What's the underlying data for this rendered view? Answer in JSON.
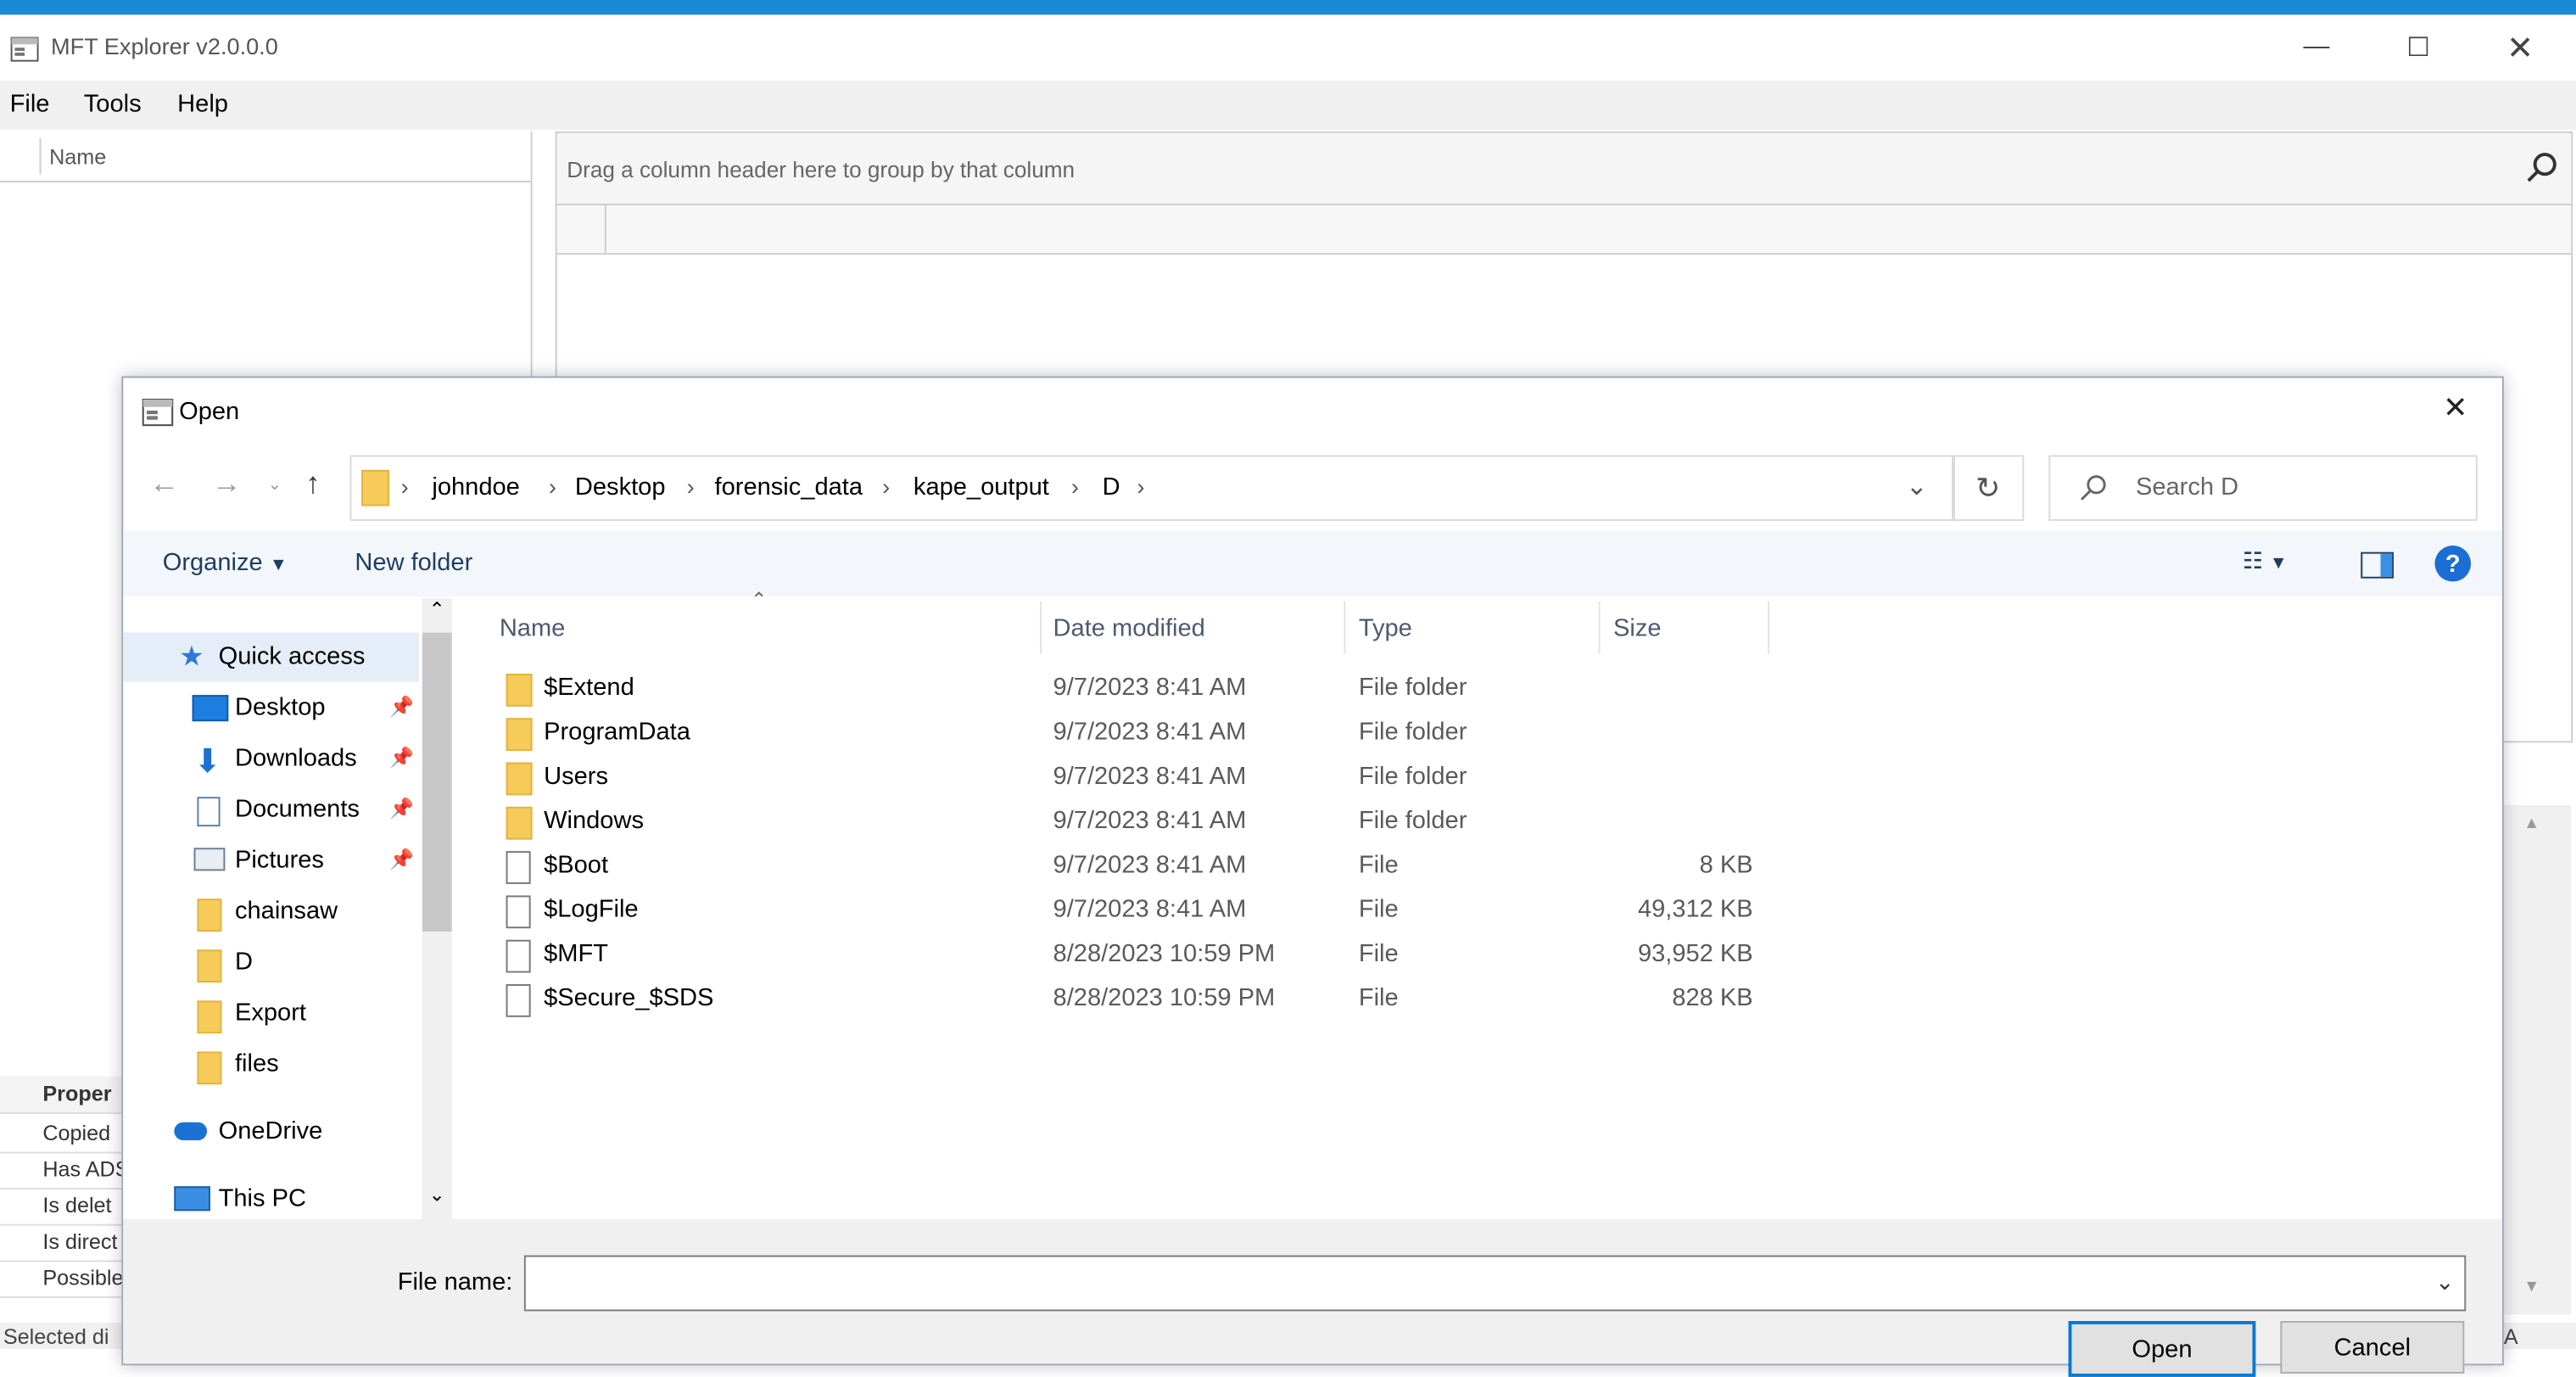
{
  "app": {
    "title": "MFT Explorer v2.0.0.0",
    "menu": [
      "File",
      "Tools",
      "Help"
    ],
    "left_header": "Name",
    "group_hint": "Drag a column header here to group by that column",
    "properties_header": "Proper",
    "properties": [
      "Copied",
      "Has ADS",
      "Is delet",
      "Is direct",
      "Possible"
    ],
    "status": "Selected di",
    "status_right": "A"
  },
  "dialog": {
    "title": "Open",
    "breadcrumb": [
      "johndoe",
      "Desktop",
      "forensic_data",
      "kape_output",
      "D"
    ],
    "search_placeholder": "Search D",
    "organize_label": "Organize",
    "new_folder_label": "New folder",
    "help_label": "?",
    "nav_items": [
      {
        "label": "Quick access",
        "icon": "star-icon",
        "selected": true
      },
      {
        "label": "Desktop",
        "icon": "desktop-icon",
        "pinned": true
      },
      {
        "label": "Downloads",
        "icon": "download-icon",
        "pinned": true
      },
      {
        "label": "Documents",
        "icon": "document-icon",
        "pinned": true
      },
      {
        "label": "Pictures",
        "icon": "picture-icon",
        "pinned": true
      },
      {
        "label": "chainsaw",
        "icon": "folder-icon"
      },
      {
        "label": "D",
        "icon": "folder-icon"
      },
      {
        "label": "Export",
        "icon": "folder-icon"
      },
      {
        "label": "files",
        "icon": "folder-icon"
      },
      {
        "label": "OneDrive",
        "icon": "cloud-icon"
      },
      {
        "label": "This PC",
        "icon": "computer-icon"
      }
    ],
    "columns": [
      "Name",
      "Date modified",
      "Type",
      "Size"
    ],
    "files": [
      {
        "name": "$Extend",
        "date": "9/7/2023 8:41 AM",
        "type": "File folder",
        "size": "",
        "kind": "folder"
      },
      {
        "name": "ProgramData",
        "date": "9/7/2023 8:41 AM",
        "type": "File folder",
        "size": "",
        "kind": "folder"
      },
      {
        "name": "Users",
        "date": "9/7/2023 8:41 AM",
        "type": "File folder",
        "size": "",
        "kind": "folder"
      },
      {
        "name": "Windows",
        "date": "9/7/2023 8:41 AM",
        "type": "File folder",
        "size": "",
        "kind": "folder"
      },
      {
        "name": "$Boot",
        "date": "9/7/2023 8:41 AM",
        "type": "File",
        "size": "8 KB",
        "kind": "file"
      },
      {
        "name": "$LogFile",
        "date": "9/7/2023 8:41 AM",
        "type": "File",
        "size": "49,312 KB",
        "kind": "file"
      },
      {
        "name": "$MFT",
        "date": "8/28/2023 10:59 PM",
        "type": "File",
        "size": "93,952 KB",
        "kind": "file"
      },
      {
        "name": "$Secure_$SDS",
        "date": "8/28/2023 10:59 PM",
        "type": "File",
        "size": "828 KB",
        "kind": "file"
      }
    ],
    "file_name_label": "File name:",
    "file_name_value": "",
    "open_label": "Open",
    "cancel_label": "Cancel"
  }
}
